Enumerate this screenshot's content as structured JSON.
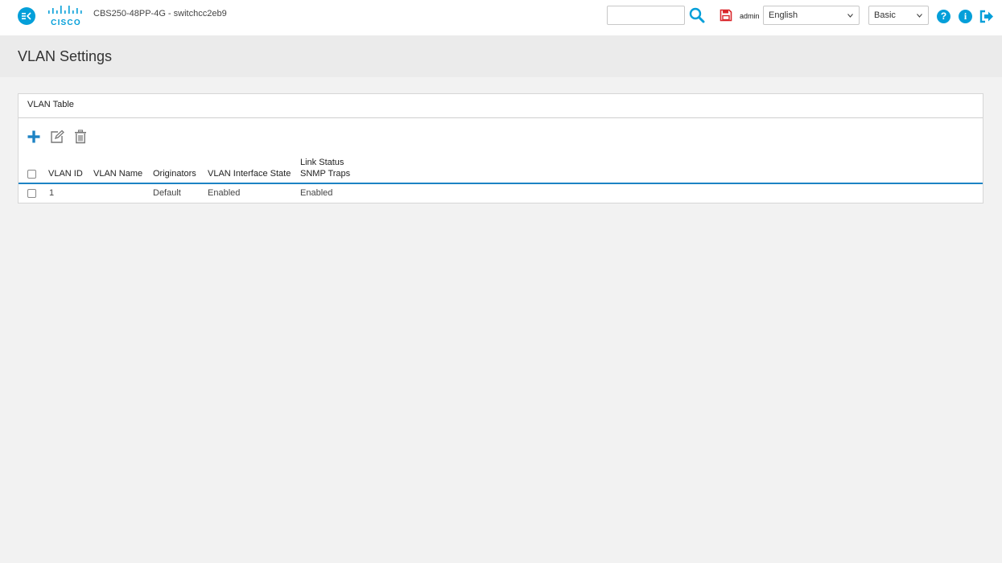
{
  "header": {
    "brand": "CISCO",
    "device_title": "CBS250-48PP-4G - switchcc2eb9",
    "search": {
      "value": "",
      "placeholder": ""
    },
    "user": "admin",
    "language": "English",
    "mode": "Basic"
  },
  "page": {
    "title": "VLAN Settings"
  },
  "panel": {
    "title": "VLAN Table",
    "columns": {
      "vlan_id": "VLAN ID",
      "vlan_name": "VLAN Name",
      "originators": "Originators",
      "interface_state": "VLAN Interface State",
      "link_status_line1": "Link Status",
      "link_status_line2": "SNMP Traps"
    },
    "rows": [
      {
        "vlan_id": "1",
        "vlan_name": "",
        "originators": "Default",
        "interface_state": "Enabled",
        "link_status": "Enabled"
      }
    ]
  },
  "colors": {
    "accent": "#049fd9",
    "save_icon": "#d9262b",
    "header_line": "#1d83c4"
  }
}
